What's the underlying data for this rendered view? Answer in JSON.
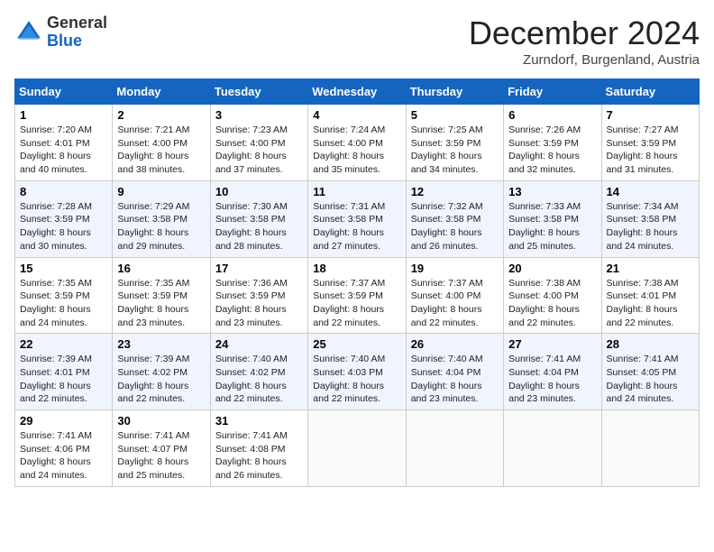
{
  "logo": {
    "general": "General",
    "blue": "Blue"
  },
  "header": {
    "month": "December 2024",
    "location": "Zurndorf, Burgenland, Austria"
  },
  "weekdays": [
    "Sunday",
    "Monday",
    "Tuesday",
    "Wednesday",
    "Thursday",
    "Friday",
    "Saturday"
  ],
  "weeks": [
    [
      {
        "day": "1",
        "sunrise": "Sunrise: 7:20 AM",
        "sunset": "Sunset: 4:01 PM",
        "daylight": "Daylight: 8 hours and 40 minutes."
      },
      {
        "day": "2",
        "sunrise": "Sunrise: 7:21 AM",
        "sunset": "Sunset: 4:00 PM",
        "daylight": "Daylight: 8 hours and 38 minutes."
      },
      {
        "day": "3",
        "sunrise": "Sunrise: 7:23 AM",
        "sunset": "Sunset: 4:00 PM",
        "daylight": "Daylight: 8 hours and 37 minutes."
      },
      {
        "day": "4",
        "sunrise": "Sunrise: 7:24 AM",
        "sunset": "Sunset: 4:00 PM",
        "daylight": "Daylight: 8 hours and 35 minutes."
      },
      {
        "day": "5",
        "sunrise": "Sunrise: 7:25 AM",
        "sunset": "Sunset: 3:59 PM",
        "daylight": "Daylight: 8 hours and 34 minutes."
      },
      {
        "day": "6",
        "sunrise": "Sunrise: 7:26 AM",
        "sunset": "Sunset: 3:59 PM",
        "daylight": "Daylight: 8 hours and 32 minutes."
      },
      {
        "day": "7",
        "sunrise": "Sunrise: 7:27 AM",
        "sunset": "Sunset: 3:59 PM",
        "daylight": "Daylight: 8 hours and 31 minutes."
      }
    ],
    [
      {
        "day": "8",
        "sunrise": "Sunrise: 7:28 AM",
        "sunset": "Sunset: 3:59 PM",
        "daylight": "Daylight: 8 hours and 30 minutes."
      },
      {
        "day": "9",
        "sunrise": "Sunrise: 7:29 AM",
        "sunset": "Sunset: 3:58 PM",
        "daylight": "Daylight: 8 hours and 29 minutes."
      },
      {
        "day": "10",
        "sunrise": "Sunrise: 7:30 AM",
        "sunset": "Sunset: 3:58 PM",
        "daylight": "Daylight: 8 hours and 28 minutes."
      },
      {
        "day": "11",
        "sunrise": "Sunrise: 7:31 AM",
        "sunset": "Sunset: 3:58 PM",
        "daylight": "Daylight: 8 hours and 27 minutes."
      },
      {
        "day": "12",
        "sunrise": "Sunrise: 7:32 AM",
        "sunset": "Sunset: 3:58 PM",
        "daylight": "Daylight: 8 hours and 26 minutes."
      },
      {
        "day": "13",
        "sunrise": "Sunrise: 7:33 AM",
        "sunset": "Sunset: 3:58 PM",
        "daylight": "Daylight: 8 hours and 25 minutes."
      },
      {
        "day": "14",
        "sunrise": "Sunrise: 7:34 AM",
        "sunset": "Sunset: 3:58 PM",
        "daylight": "Daylight: 8 hours and 24 minutes."
      }
    ],
    [
      {
        "day": "15",
        "sunrise": "Sunrise: 7:35 AM",
        "sunset": "Sunset: 3:59 PM",
        "daylight": "Daylight: 8 hours and 24 minutes."
      },
      {
        "day": "16",
        "sunrise": "Sunrise: 7:35 AM",
        "sunset": "Sunset: 3:59 PM",
        "daylight": "Daylight: 8 hours and 23 minutes."
      },
      {
        "day": "17",
        "sunrise": "Sunrise: 7:36 AM",
        "sunset": "Sunset: 3:59 PM",
        "daylight": "Daylight: 8 hours and 23 minutes."
      },
      {
        "day": "18",
        "sunrise": "Sunrise: 7:37 AM",
        "sunset": "Sunset: 3:59 PM",
        "daylight": "Daylight: 8 hours and 22 minutes."
      },
      {
        "day": "19",
        "sunrise": "Sunrise: 7:37 AM",
        "sunset": "Sunset: 4:00 PM",
        "daylight": "Daylight: 8 hours and 22 minutes."
      },
      {
        "day": "20",
        "sunrise": "Sunrise: 7:38 AM",
        "sunset": "Sunset: 4:00 PM",
        "daylight": "Daylight: 8 hours and 22 minutes."
      },
      {
        "day": "21",
        "sunrise": "Sunrise: 7:38 AM",
        "sunset": "Sunset: 4:01 PM",
        "daylight": "Daylight: 8 hours and 22 minutes."
      }
    ],
    [
      {
        "day": "22",
        "sunrise": "Sunrise: 7:39 AM",
        "sunset": "Sunset: 4:01 PM",
        "daylight": "Daylight: 8 hours and 22 minutes."
      },
      {
        "day": "23",
        "sunrise": "Sunrise: 7:39 AM",
        "sunset": "Sunset: 4:02 PM",
        "daylight": "Daylight: 8 hours and 22 minutes."
      },
      {
        "day": "24",
        "sunrise": "Sunrise: 7:40 AM",
        "sunset": "Sunset: 4:02 PM",
        "daylight": "Daylight: 8 hours and 22 minutes."
      },
      {
        "day": "25",
        "sunrise": "Sunrise: 7:40 AM",
        "sunset": "Sunset: 4:03 PM",
        "daylight": "Daylight: 8 hours and 22 minutes."
      },
      {
        "day": "26",
        "sunrise": "Sunrise: 7:40 AM",
        "sunset": "Sunset: 4:04 PM",
        "daylight": "Daylight: 8 hours and 23 minutes."
      },
      {
        "day": "27",
        "sunrise": "Sunrise: 7:41 AM",
        "sunset": "Sunset: 4:04 PM",
        "daylight": "Daylight: 8 hours and 23 minutes."
      },
      {
        "day": "28",
        "sunrise": "Sunrise: 7:41 AM",
        "sunset": "Sunset: 4:05 PM",
        "daylight": "Daylight: 8 hours and 24 minutes."
      }
    ],
    [
      {
        "day": "29",
        "sunrise": "Sunrise: 7:41 AM",
        "sunset": "Sunset: 4:06 PM",
        "daylight": "Daylight: 8 hours and 24 minutes."
      },
      {
        "day": "30",
        "sunrise": "Sunrise: 7:41 AM",
        "sunset": "Sunset: 4:07 PM",
        "daylight": "Daylight: 8 hours and 25 minutes."
      },
      {
        "day": "31",
        "sunrise": "Sunrise: 7:41 AM",
        "sunset": "Sunset: 4:08 PM",
        "daylight": "Daylight: 8 hours and 26 minutes."
      },
      null,
      null,
      null,
      null
    ]
  ]
}
